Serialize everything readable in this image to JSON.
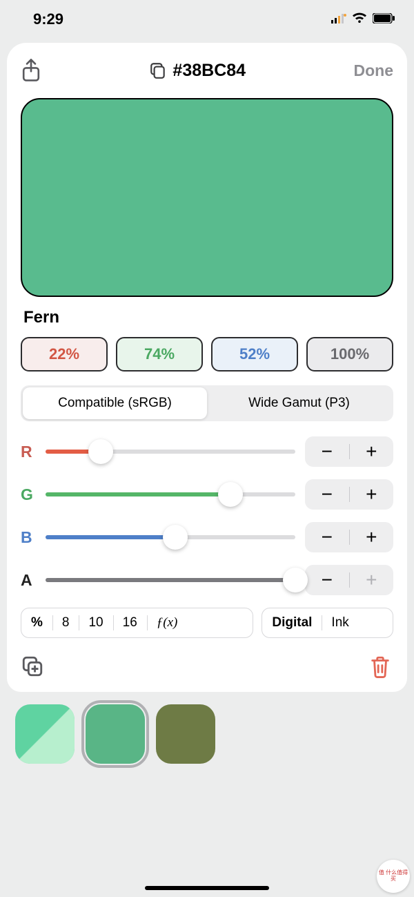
{
  "status": {
    "time": "9:29"
  },
  "header": {
    "hex": "#38BC84",
    "done": "Done"
  },
  "swatch": {
    "color": "#59bb8e"
  },
  "color_name": "Fern",
  "percents": {
    "r": "22%",
    "g": "74%",
    "b": "52%",
    "a": "100%"
  },
  "gamut": {
    "compatible": "Compatible (sRGB)",
    "wide": "Wide Gamut (P3)"
  },
  "sliders": {
    "r": {
      "label": "R",
      "value": 22,
      "color": "#e35d45"
    },
    "g": {
      "label": "G",
      "value": 74,
      "color": "#55b668"
    },
    "b": {
      "label": "B",
      "value": 52,
      "color": "#4e7fc8"
    },
    "a": {
      "label": "A",
      "value": 100,
      "color": "#7a7a7e"
    }
  },
  "format_bar": {
    "pct": "%",
    "b8": "8",
    "b10": "10",
    "b16": "16",
    "fx": "ƒ(x)"
  },
  "mode_bar": {
    "digital": "Digital",
    "ink": "Ink"
  },
  "palette": [
    {
      "c1": "#5fd3a1",
      "c2": "#b7efce",
      "selected": false
    },
    {
      "c1": "#59b586",
      "c2": "#59b586",
      "selected": true
    },
    {
      "c1": "#6e7b45",
      "c2": "#6e7b45",
      "selected": false
    }
  ],
  "watermark": "值 什么值得买"
}
